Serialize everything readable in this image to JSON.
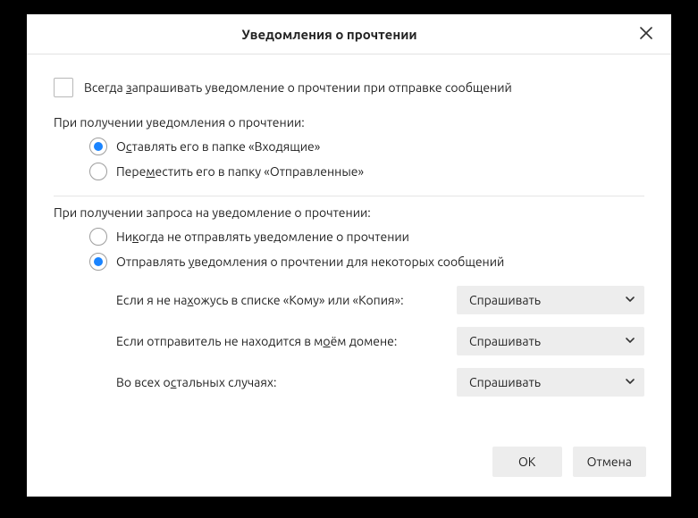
{
  "dialog": {
    "title": "Уведомления о прочтении",
    "always_request": {
      "checked": false,
      "label_pre": "Всегда ",
      "label_u": "з",
      "label_post": "апрашивать уведомление о прочтении при отправке сообщений"
    },
    "on_receipt_notification": {
      "heading": "При получении уведомления о прочтении:",
      "leave_in_inbox": {
        "selected": true,
        "pre": "О",
        "u": "с",
        "post": "тавлять его в папке «Входящие»"
      },
      "move_to_sent": {
        "selected": false,
        "pre": "Пере",
        "u": "м",
        "post": "естить его в папку «Отправленные»"
      }
    },
    "on_receipt_request": {
      "heading": "При получении запроса на уведомление о прочтении:",
      "never_send": {
        "selected": false,
        "pre": "Ни",
        "u": "к",
        "post": "огда не отправлять уведомление о прочтении"
      },
      "send_some": {
        "selected": true,
        "pre": "Отправлять ",
        "u": "у",
        "post": "ведомления о прочтении для некоторых сообщений"
      },
      "if_not_in_to_cc": {
        "pre": "Если я не на",
        "u": "х",
        "post": "ожусь в списке «Кому» или «Копия»:",
        "value": "Спрашивать"
      },
      "if_sender_not_in_domain": {
        "pre": "Если отправитель не находится в м",
        "u": "о",
        "post": "ём домене:",
        "value": "Спрашивать"
      },
      "all_other_cases": {
        "pre": "Во всех о",
        "u": "с",
        "post": "тальных случаях:",
        "value": "Спрашивать"
      }
    },
    "buttons": {
      "ok": "OK",
      "cancel": "Отмена"
    }
  }
}
